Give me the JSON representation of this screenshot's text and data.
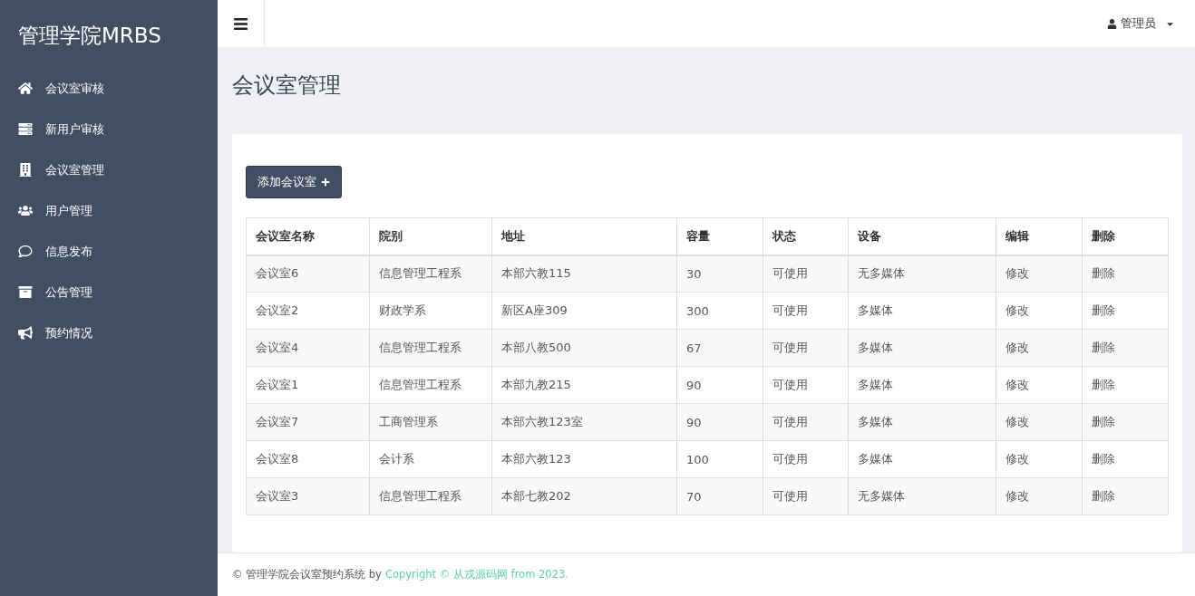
{
  "sidebar": {
    "brand": "管理学院MRBS",
    "items": [
      {
        "label": "会议室审核"
      },
      {
        "label": "新用户审核"
      },
      {
        "label": "会议室管理"
      },
      {
        "label": "用户管理"
      },
      {
        "label": "信息发布"
      },
      {
        "label": "公告管理"
      },
      {
        "label": "预约情况"
      }
    ]
  },
  "topbar": {
    "user": "管理员"
  },
  "page_title": "会议室管理",
  "add_button": "添加会议室",
  "table": {
    "columns": [
      "会议室名称",
      "院别",
      "地址",
      "容量",
      "状态",
      "设备",
      "编辑",
      "删除"
    ],
    "rows": [
      [
        "会议室6",
        "信息管理工程系",
        "本部六教115",
        "30",
        "可使用",
        "无多媒体",
        "修改",
        "删除"
      ],
      [
        "会议室2",
        "财政学系",
        "新区A座309",
        "300",
        "可使用",
        "多媒体",
        "修改",
        "删除"
      ],
      [
        "会议室4",
        "信息管理工程系",
        "本部八教500",
        "67",
        "可使用",
        "多媒体",
        "修改",
        "删除"
      ],
      [
        "会议室1",
        "信息管理工程系",
        "本部九教215",
        "90",
        "可使用",
        "多媒体",
        "修改",
        "删除"
      ],
      [
        "会议室7",
        "工商管理系",
        "本部六教123室",
        "90",
        "可使用",
        "多媒体",
        "修改",
        "删除"
      ],
      [
        "会议室8",
        "会计系",
        "本部六教123",
        "100",
        "可使用",
        "多媒体",
        "修改",
        "删除"
      ],
      [
        "会议室3",
        "信息管理工程系",
        "本部七教202",
        "70",
        "可使用",
        "无多媒体",
        "修改",
        "删除"
      ]
    ]
  },
  "footer": {
    "text": "© 管理学院会议室预约系统 by",
    "link": "Copyright © 从戎源码网 from 2023."
  }
}
